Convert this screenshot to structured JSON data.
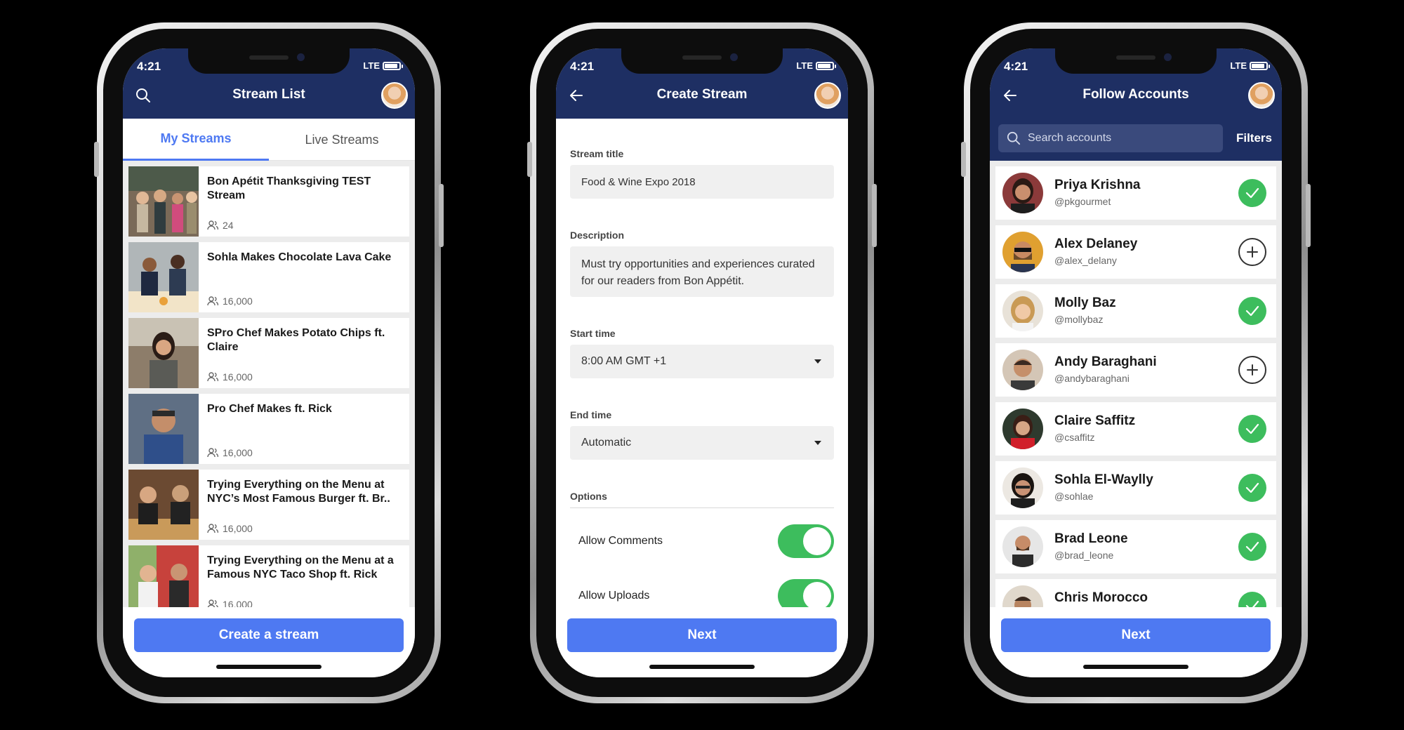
{
  "status_bar": {
    "time": "4:21",
    "network": "LTE"
  },
  "screens": [
    {
      "title": "Stream List",
      "tabs": [
        "My Streams",
        "Live Streams"
      ],
      "streams": [
        {
          "title": "Bon Apétit Thanksgiving TEST Stream",
          "viewers": "24"
        },
        {
          "title": "Sohla Makes Chocolate Lava Cake",
          "viewers": "16,000"
        },
        {
          "title": "SPro Chef Makes Potato Chips ft. Claire",
          "viewers": "16,000"
        },
        {
          "title": "Pro Chef Makes ft. Rick",
          "viewers": "16,000"
        },
        {
          "title": "Trying Everything on the Menu at NYC’s Most Famous Burger ft. Br..",
          "viewers": "16,000"
        },
        {
          "title": "Trying Everything on the Menu at a Famous NYC Taco Shop ft. Rick",
          "viewers": "16,000"
        }
      ],
      "button": "Create a stream"
    },
    {
      "title": "Create Stream",
      "fields": {
        "stream_title_label": "Stream title",
        "stream_title_value": "Food & Wine Expo 2018",
        "description_label": "Description",
        "description_value": "Must try opportunities and experiences curated for our readers from Bon Appétit.",
        "start_time_label": "Start time",
        "start_time_value": "8:00 AM GMT +1",
        "end_time_label": "End time",
        "end_time_value": "Automatic",
        "options_label": "Options"
      },
      "toggles": [
        {
          "label": "Allow Comments",
          "on": true
        },
        {
          "label": "Allow Uploads",
          "on": true
        }
      ],
      "button": "Next"
    },
    {
      "title": "Follow Accounts",
      "search_placeholder": "Search accounts",
      "filters_label": "Filters",
      "accounts": [
        {
          "name": "Priya Krishna",
          "handle": "@pkgourmet",
          "following": true
        },
        {
          "name": "Alex Delaney",
          "handle": "@alex_delany",
          "following": false
        },
        {
          "name": "Molly Baz",
          "handle": "@mollybaz",
          "following": true
        },
        {
          "name": "Andy Baraghani",
          "handle": "@andybaraghani",
          "following": false
        },
        {
          "name": "Claire Saffitz",
          "handle": "@csaffitz",
          "following": true
        },
        {
          "name": "Sohla El-Waylly",
          "handle": "@sohlae",
          "following": true
        },
        {
          "name": "Brad Leone",
          "handle": "@brad_leone",
          "following": true
        },
        {
          "name": "Chris Morocco",
          "handle": "",
          "following": true
        }
      ],
      "button": "Next"
    }
  ],
  "colors": {
    "navbar": "#1e2f63",
    "accent": "#4e79f2",
    "success": "#3dbd5d"
  }
}
